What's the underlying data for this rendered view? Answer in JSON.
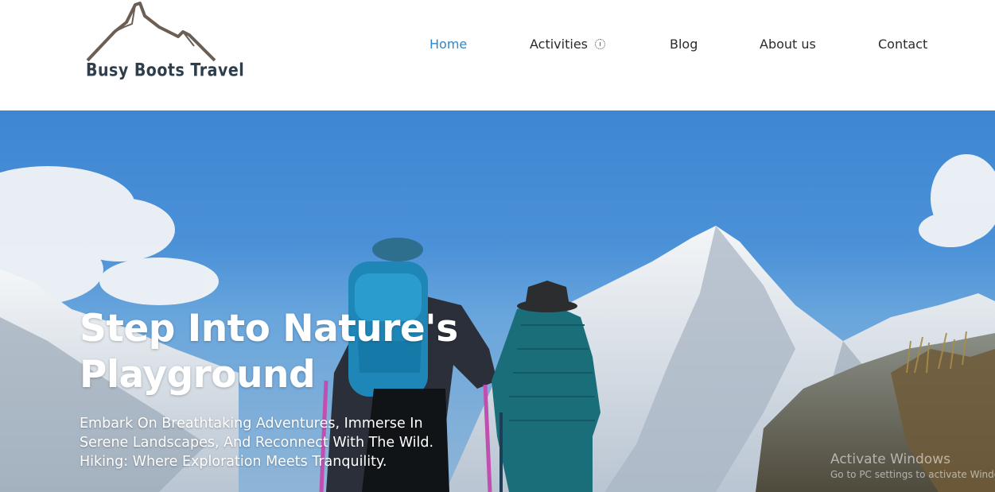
{
  "brand": {
    "logo_text": "Busy Boots Travel"
  },
  "nav": {
    "home": "Home",
    "activities": "Activities",
    "blog": "Blog",
    "about": "About us",
    "contact": "Contact",
    "active_color": "#2f86c9",
    "text_color": "#2b2b2b"
  },
  "hero": {
    "title": "Step Into Nature's Playground",
    "subtitle": "Embark On Breathtaking Adventures, Immerse In Serene Landscapes, And Reconnect With The Wild. Hiking: Where Exploration Meets Tranquility."
  },
  "watermark": {
    "title": "Activate Windows",
    "subtitle": "Go to PC settings to activate Windows."
  }
}
